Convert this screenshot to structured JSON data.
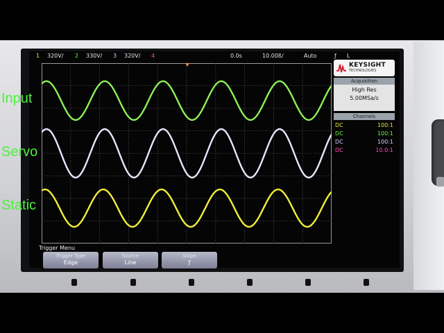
{
  "status": {
    "ch1_num": "1",
    "ch1_scale": "320V/",
    "ch2_num": "2",
    "ch2_scale": "330V/",
    "ch3_num": "3",
    "ch3_scale": "320V/",
    "ch4_num": "4",
    "time_offset": "0.0s",
    "time_scale": "10.00ß/",
    "trigger_mode": "Auto",
    "trigger_icon": "ƒ",
    "trigger_source": "L"
  },
  "labels": {
    "input": "Input",
    "servo": "Servo",
    "static": "Static"
  },
  "panel": {
    "brand": "KEYSIGHT",
    "brand_sub": "TECHNOLOGIES",
    "acq_header": "Acquisition",
    "acq_mode": "High Res",
    "sample_rate": "5.00MSa/s",
    "channels_header": "Channels",
    "channels": [
      {
        "coupling": "DC",
        "probe": "100:1",
        "color": "#e9e641"
      },
      {
        "coupling": "DC",
        "probe": "100:1",
        "color": "#6ef04a"
      },
      {
        "coupling": "DC",
        "probe": "100:1",
        "color": "#cfd3ff"
      },
      {
        "coupling": "DC",
        "probe": "10.0:1",
        "color": "#ff4fb5"
      }
    ]
  },
  "menu": {
    "title": "Trigger Menu",
    "keys": [
      {
        "title": "Trigger Type",
        "value": "Edge"
      },
      {
        "title": "Source",
        "value": "Line"
      },
      {
        "title": "Slope",
        "value": "ƒ"
      }
    ]
  },
  "colors": {
    "input_trace": "#8ff05a",
    "servo_trace": "#e6e8ff",
    "static_trace": "#f2ee3a",
    "label_green": "#4cf03a"
  }
}
